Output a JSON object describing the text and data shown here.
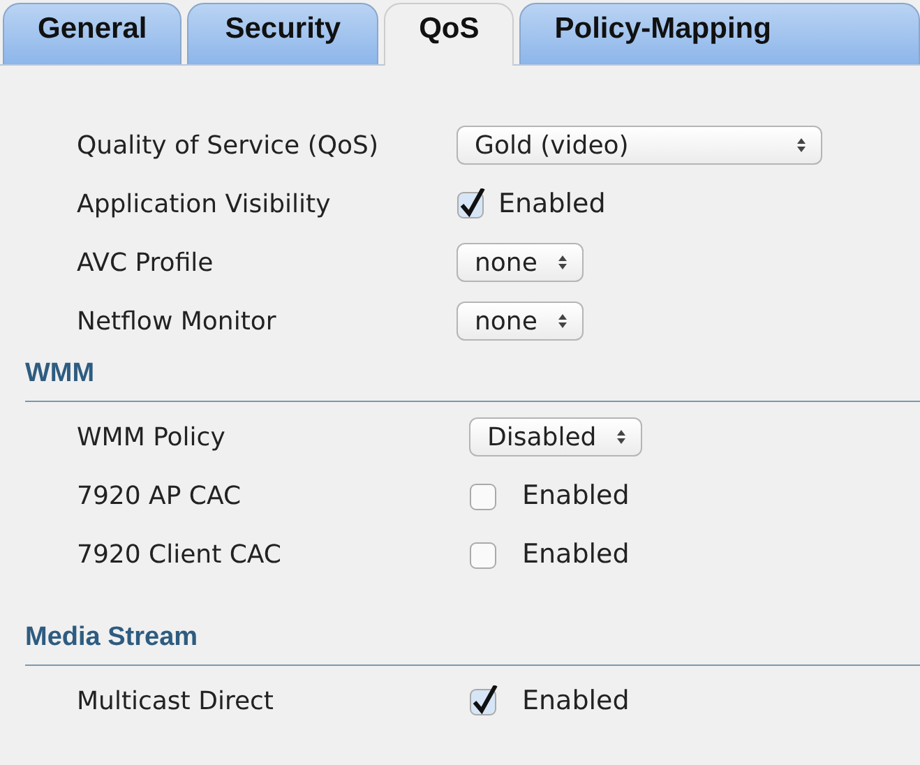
{
  "tabs": [
    {
      "label": "General",
      "selected": false
    },
    {
      "label": "Security",
      "selected": false
    },
    {
      "label": "QoS",
      "selected": true
    },
    {
      "label": "Policy-Mapping",
      "selected": false
    }
  ],
  "sections": [
    {
      "rows": [
        {
          "kind": "select",
          "label": "Quality of Service (QoS)",
          "value": "Gold (video)"
        },
        {
          "kind": "checkbox",
          "label": "Application Visibility",
          "checked": true,
          "text": "Enabled"
        },
        {
          "kind": "select",
          "label": "AVC Profile",
          "value": "none"
        },
        {
          "kind": "select",
          "label": "Netflow Monitor",
          "value": "none"
        }
      ]
    },
    {
      "heading": "WMM",
      "rows": [
        {
          "kind": "select",
          "label": "WMM Policy",
          "value": "Disabled"
        },
        {
          "kind": "checkbox",
          "label": "7920 AP CAC",
          "checked": false,
          "text": "Enabled"
        },
        {
          "kind": "checkbox",
          "label": "7920 Client CAC",
          "checked": false,
          "text": "Enabled"
        }
      ]
    },
    {
      "heading": "Media Stream",
      "rows": [
        {
          "kind": "checkbox",
          "label": "Multicast Direct",
          "checked": true,
          "text": "Enabled"
        }
      ]
    }
  ]
}
